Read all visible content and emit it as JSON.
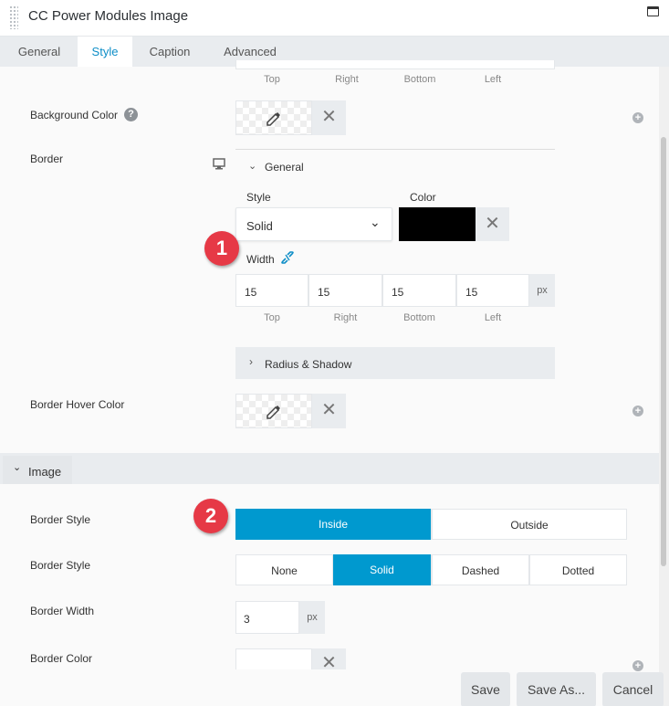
{
  "window": {
    "title": "CC Power Modules Image"
  },
  "tabs": [
    {
      "label": "General",
      "active": false
    },
    {
      "label": "Style",
      "active": true
    },
    {
      "label": "Caption",
      "active": false
    },
    {
      "label": "Advanced",
      "active": false
    }
  ],
  "top_dims": {
    "top": "Top",
    "right": "Right",
    "bottom": "Bottom",
    "left": "Left"
  },
  "background_color": {
    "label": "Background Color"
  },
  "border": {
    "label": "Border",
    "general_label": "General",
    "style_label": "Style",
    "style_value": "Solid",
    "color_label": "Color",
    "color_value": "#000000",
    "width_label": "Width",
    "width_values": {
      "top": "15",
      "right": "15",
      "bottom": "15",
      "left": "15"
    },
    "width_unit": "px",
    "dims": {
      "top": "Top",
      "right": "Right",
      "bottom": "Bottom",
      "left": "Left"
    },
    "radius_shadow_label": "Radius & Shadow"
  },
  "border_hover_color": {
    "label": "Border Hover Color"
  },
  "image_section": {
    "header": "Image",
    "border_style_1": {
      "label": "Border Style",
      "options": [
        "Inside",
        "Outside"
      ],
      "selected": "Inside"
    },
    "border_style_2": {
      "label": "Border Style",
      "options": [
        "None",
        "Solid",
        "Dashed",
        "Dotted"
      ],
      "selected": "Solid"
    },
    "border_width": {
      "label": "Border Width",
      "value": "3",
      "unit": "px"
    },
    "border_color": {
      "label": "Border Color"
    }
  },
  "annotations": {
    "badge1": "1",
    "badge2": "2"
  },
  "footer": {
    "save": "Save",
    "save_as": "Save As...",
    "cancel": "Cancel"
  },
  "colors": {
    "accent": "#0099cf",
    "badge": "#e63946",
    "link_icon": "#0e8ec7"
  }
}
